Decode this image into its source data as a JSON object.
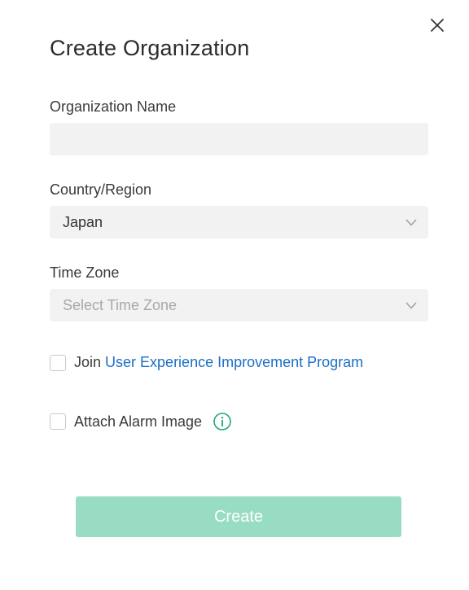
{
  "dialog": {
    "title": "Create Organization",
    "close_icon": "close-icon"
  },
  "form": {
    "org_name": {
      "label": "Organization Name",
      "value": "",
      "placeholder": ""
    },
    "country": {
      "label": "Country/Region",
      "value": "Japan",
      "icon": "chevron-down-icon"
    },
    "timezone": {
      "label": "Time Zone",
      "placeholder": "Select Time Zone",
      "icon": "chevron-down-icon"
    },
    "join_program": {
      "prefix": "Join",
      "link_text": "User Experience Improvement Program",
      "checked": false
    },
    "attach_alarm": {
      "label": "Attach Alarm Image",
      "checked": false,
      "icon": "info-icon"
    }
  },
  "actions": {
    "create_label": "Create",
    "enabled": false
  },
  "colors": {
    "accent": "#98dcc4",
    "link": "#1a6fc4",
    "info_icon": "#1fa67a",
    "field_bg": "#f2f2f2"
  }
}
